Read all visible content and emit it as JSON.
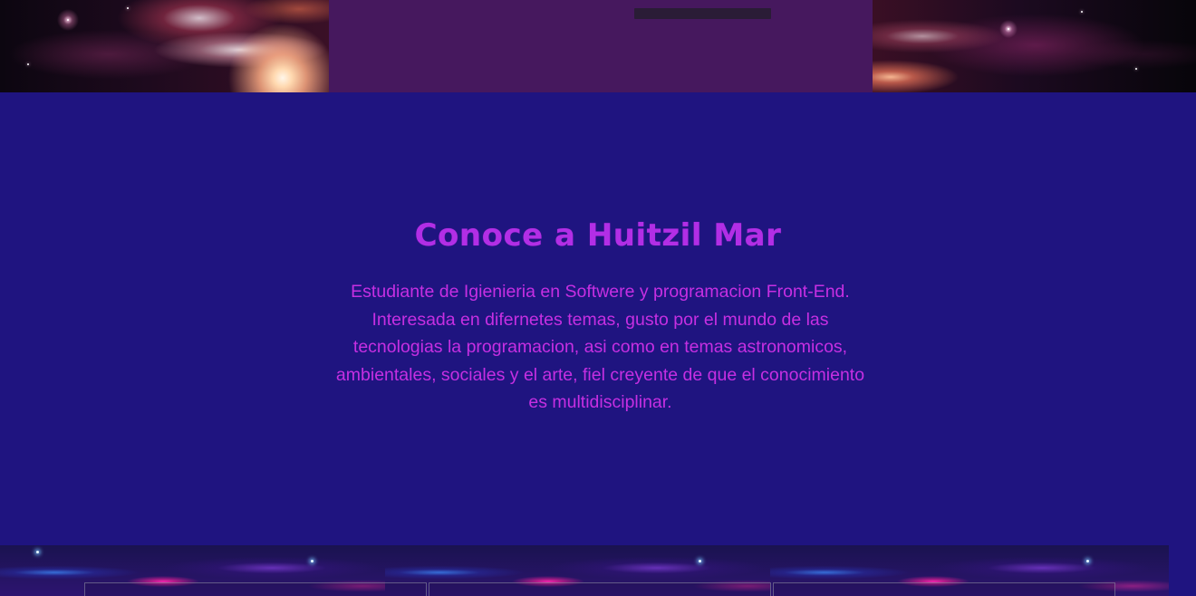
{
  "about": {
    "title": "Conoce a Huitzil Mar",
    "description": "Estudiante de Igienieria en Softwere y programacion Front-End. Interesada en difernetes temas, gusto por el mundo de las tecnologias la programacion, asi como en temas astronomicos, ambientales, sociales y el arte, fiel creyente de que el conocimiento es multidisciplinar."
  },
  "colors": {
    "section_background": "#1f1480",
    "hero_center": "#46185e",
    "accent_title": "#b22ee6",
    "accent_text": "#c62fe2"
  },
  "images": {
    "hero_left": "spiral-galaxy-image",
    "hero_right": "spiral-galaxy-image",
    "bottom": "nebula-image"
  }
}
